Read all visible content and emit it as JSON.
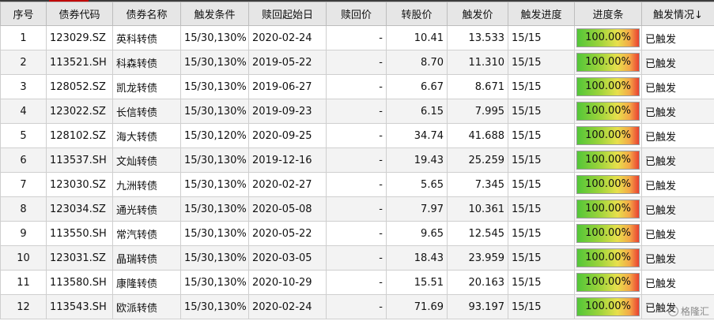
{
  "table": {
    "headers": [
      "序号",
      "债券代码",
      "债券名称",
      "触发条件",
      "赎回起始日",
      "赎回价",
      "转股价",
      "触发价",
      "触发进度",
      "进度条",
      "触发情况↓"
    ],
    "rows": [
      {
        "no": "1",
        "code": "123029.SZ",
        "name": "英科转债",
        "cond": "15/30,130%",
        "start": "2020-02-24",
        "redeem": "-",
        "conv": "10.41",
        "trigger": "13.533",
        "progress": "15/15",
        "bar": "100.00%",
        "bar_fraction": 1.0,
        "status": "已触发"
      },
      {
        "no": "2",
        "code": "113521.SH",
        "name": "科森转债",
        "cond": "15/30,130%",
        "start": "2019-05-22",
        "redeem": "-",
        "conv": "8.70",
        "trigger": "11.310",
        "progress": "15/15",
        "bar": "100.00%",
        "bar_fraction": 1.0,
        "status": "已触发"
      },
      {
        "no": "3",
        "code": "128052.SZ",
        "name": "凯龙转债",
        "cond": "15/30,130%",
        "start": "2019-06-27",
        "redeem": "-",
        "conv": "6.67",
        "trigger": "8.671",
        "progress": "15/15",
        "bar": "100.00%",
        "bar_fraction": 1.0,
        "status": "已触发"
      },
      {
        "no": "4",
        "code": "123022.SZ",
        "name": "长信转债",
        "cond": "15/30,130%",
        "start": "2019-09-23",
        "redeem": "-",
        "conv": "6.15",
        "trigger": "7.995",
        "progress": "15/15",
        "bar": "100.00%",
        "bar_fraction": 1.0,
        "status": "已触发"
      },
      {
        "no": "5",
        "code": "128102.SZ",
        "name": "海大转债",
        "cond": "15/30,120%",
        "start": "2020-09-25",
        "redeem": "-",
        "conv": "34.74",
        "trigger": "41.688",
        "progress": "15/15",
        "bar": "100.00%",
        "bar_fraction": 1.0,
        "status": "已触发"
      },
      {
        "no": "6",
        "code": "113537.SH",
        "name": "文灿转债",
        "cond": "15/30,130%",
        "start": "2019-12-16",
        "redeem": "-",
        "conv": "19.43",
        "trigger": "25.259",
        "progress": "15/15",
        "bar": "100.00%",
        "bar_fraction": 1.0,
        "status": "已触发"
      },
      {
        "no": "7",
        "code": "123030.SZ",
        "name": "九洲转债",
        "cond": "15/30,130%",
        "start": "2020-02-27",
        "redeem": "-",
        "conv": "5.65",
        "trigger": "7.345",
        "progress": "15/15",
        "bar": "100.00%",
        "bar_fraction": 1.0,
        "status": "已触发"
      },
      {
        "no": "8",
        "code": "123034.SZ",
        "name": "通光转债",
        "cond": "15/30,130%",
        "start": "2020-05-08",
        "redeem": "-",
        "conv": "7.97",
        "trigger": "10.361",
        "progress": "15/15",
        "bar": "100.00%",
        "bar_fraction": 1.0,
        "status": "已触发"
      },
      {
        "no": "9",
        "code": "113550.SH",
        "name": "常汽转债",
        "cond": "15/30,130%",
        "start": "2020-05-22",
        "redeem": "-",
        "conv": "9.65",
        "trigger": "12.545",
        "progress": "15/15",
        "bar": "100.00%",
        "bar_fraction": 1.0,
        "status": "已触发"
      },
      {
        "no": "10",
        "code": "123031.SZ",
        "name": "晶瑞转债",
        "cond": "15/30,130%",
        "start": "2020-03-05",
        "redeem": "-",
        "conv": "18.43",
        "trigger": "23.959",
        "progress": "15/15",
        "bar": "100.00%",
        "bar_fraction": 1.0,
        "status": "已触发"
      },
      {
        "no": "11",
        "code": "113580.SH",
        "name": "康隆转债",
        "cond": "15/30,130%",
        "start": "2020-10-29",
        "redeem": "-",
        "conv": "15.51",
        "trigger": "20.163",
        "progress": "15/15",
        "bar": "100.00%",
        "bar_fraction": 1.0,
        "status": "已触发"
      },
      {
        "no": "12",
        "code": "113543.SH",
        "name": "欧派转债",
        "cond": "15/30,130%",
        "start": "2020-02-24",
        "redeem": "-",
        "conv": "71.69",
        "trigger": "93.197",
        "progress": "15/15",
        "bar": "100.00%",
        "bar_fraction": 1.0,
        "status": "已触发"
      }
    ]
  },
  "watermark": {
    "text": "格隆汇",
    "icon": "gelonghui-logo-icon"
  },
  "colors": {
    "header_bg": "#e6e6e6",
    "row_alt": "#f3f3f3",
    "bar_start": "#53c639",
    "bar_end": "#ea4030",
    "top_accent": "#c00000"
  }
}
